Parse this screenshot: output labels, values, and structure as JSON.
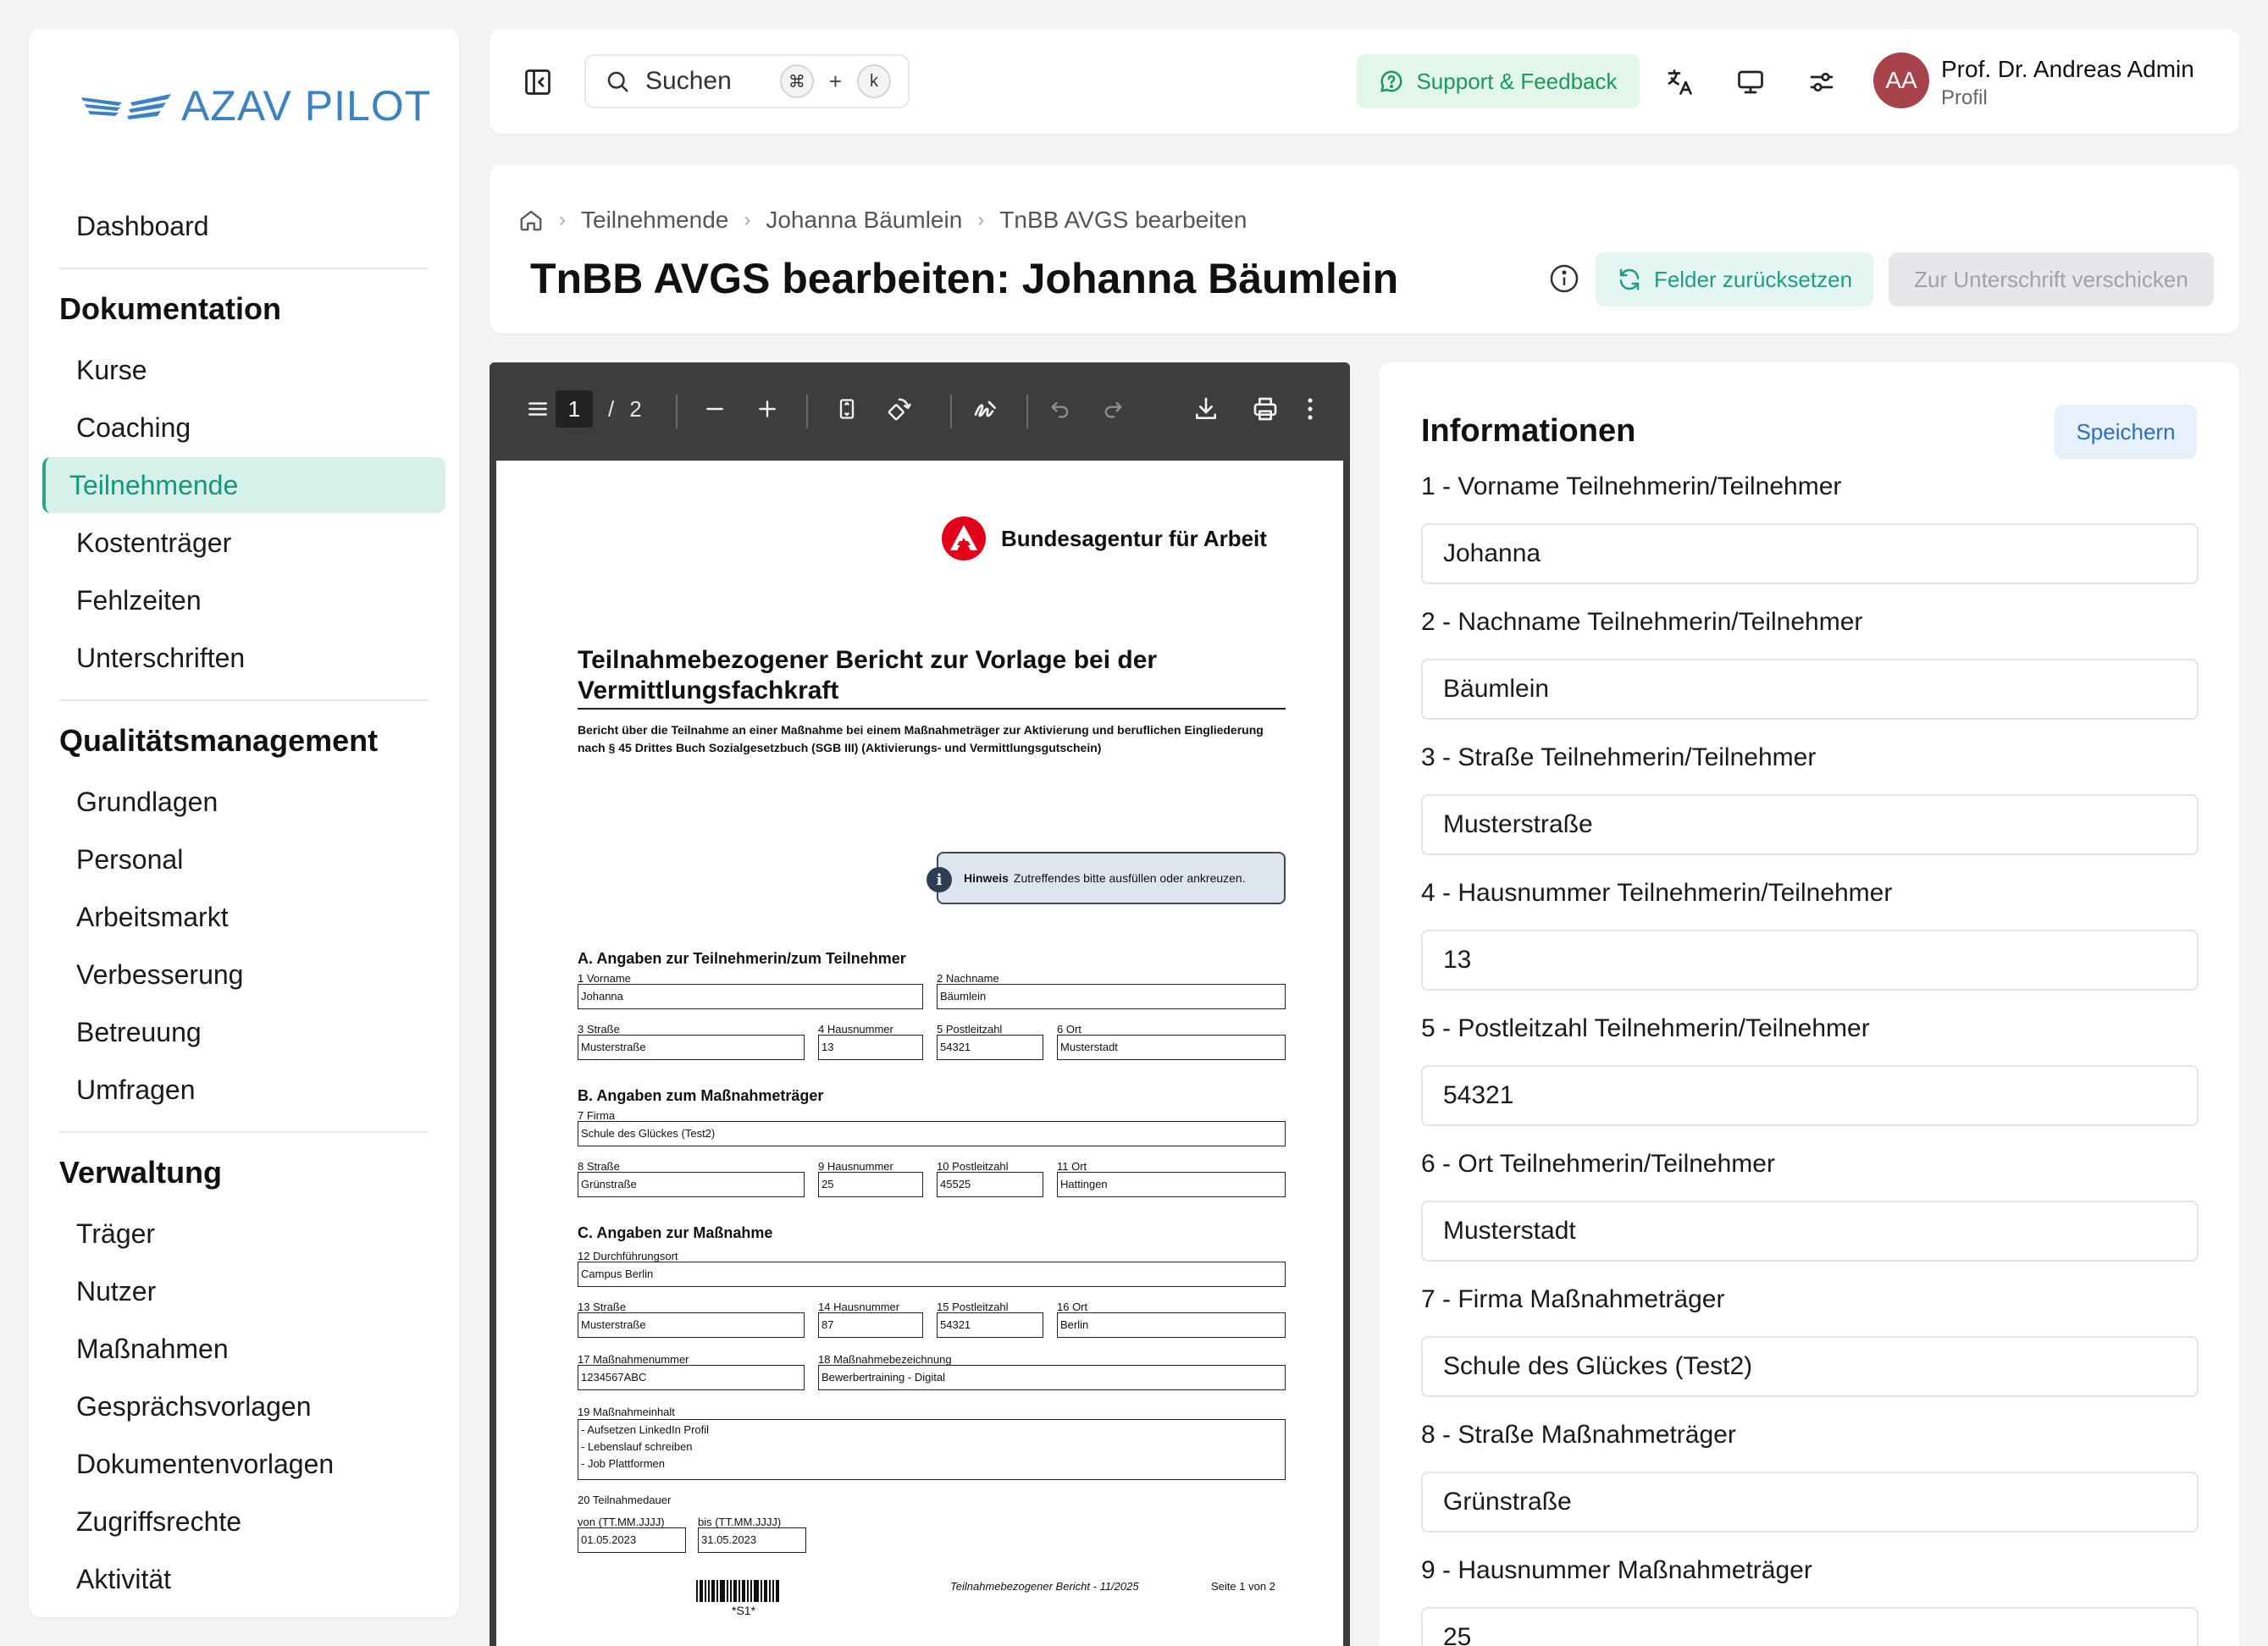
{
  "sidebar": {
    "logo_text": "AZAV PILOT",
    "dashboard": "Dashboard",
    "sections": [
      {
        "title": "Dokumentation",
        "items": [
          "Kurse",
          "Coaching",
          "Teilnehmende",
          "Kostenträger",
          "Fehlzeiten",
          "Unterschriften"
        ]
      },
      {
        "title": "Qualitätsmanagement",
        "items": [
          "Grundlagen",
          "Personal",
          "Arbeitsmarkt",
          "Verbesserung",
          "Betreuung",
          "Umfragen"
        ]
      },
      {
        "title": "Verwaltung",
        "items": [
          "Träger",
          "Nutzer",
          "Maßnahmen",
          "Gesprächsvorlagen",
          "Dokumentenvorlagen",
          "Zugriffsrechte",
          "Aktivität"
        ]
      }
    ],
    "active_item": "Teilnehmende"
  },
  "topbar": {
    "search_label": "Suchen",
    "shortcut_key1": "⌘",
    "shortcut_plus": "+",
    "shortcut_key2": "k",
    "support_label": "Support & Feedback",
    "avatar_initials": "AA",
    "user_name": "Prof. Dr. Andreas Admin",
    "user_sub": "Profil"
  },
  "header": {
    "breadcrumbs": [
      "Teilnehmende",
      "Johanna Bäumlein",
      "TnBB AVGS bearbeiten"
    ],
    "title": "TnBB AVGS bearbeiten: Johanna Bäumlein",
    "reset_label": "Felder zurücksetzen",
    "sign_label": "Zur Unterschrift verschicken"
  },
  "pdf": {
    "current_page": "1",
    "page_sep": "/",
    "total_pages": "2",
    "org_name": "Bundesagentur für Arbeit",
    "title": "Teilnahmebezogener Bericht zur Vorlage bei der Vermittlungsfachkraft",
    "intro": "Bericht über die Teilnahme an einer Maßnahme bei einem Maßnahmeträger zur Aktivierung und beruflichen Eingliederung nach § 45 Drittes Buch Sozialgesetzbuch (SGB III) (Aktivierungs- und Vermittlungsgutschein)",
    "hint_bold": "Hinweis",
    "hint_text": "Zutreffendes bitte ausfüllen oder ankreuzen.",
    "section_a": "A.  Angaben zur Teilnehmerin/zum Teilnehmer",
    "section_b": "B.  Angaben zum Maßnahmeträger",
    "section_c": "C.  Angaben zur Maßnahme",
    "labels": {
      "l1": "1  Vorname",
      "l2": "2  Nachname",
      "l3": "3  Straße",
      "l4": "4  Hausnummer",
      "l5": "5  Postleitzahl",
      "l6": "6  Ort",
      "l7": "7  Firma",
      "l8": "8  Straße",
      "l9": "9  Hausnummer",
      "l10": "10  Postleitzahl",
      "l11": "11  Ort",
      "l12": "12  Durchführungsort",
      "l13": "13  Straße",
      "l14": "14  Hausnummer",
      "l15": "15  Postleitzahl",
      "l16": "16  Ort",
      "l17": "17  Maßnahmenummer",
      "l18": "18  Maßnahmebezeichnung",
      "l19": "19  Maßnahmeinhalt",
      "l20": "20  Teilnahmedauer",
      "von": "von (TT.MM.JJJJ)",
      "bis": "bis (TT.MM.JJJJ)"
    },
    "values": {
      "v1": "Johanna",
      "v2": "Bäumlein",
      "v3": "Musterstraße",
      "v4": "13",
      "v5": "54321",
      "v6": "Musterstadt",
      "v7": "Schule des Glückes (Test2)",
      "v8": "Grünstraße",
      "v9": "25",
      "v10": "45525",
      "v11": "Hattingen",
      "v12": "Campus Berlin",
      "v13": "Musterstraße",
      "v14": "87",
      "v15": "54321",
      "v16": "Berlin",
      "v17": "1234567ABC",
      "v18": "Bewerbertraining - Digital",
      "v19": "- Aufsetzen LinkedIn Profil\n- Lebenslauf schreiben\n- Job Plattformen",
      "von": "01.05.2023",
      "bis": "31.05.2023"
    },
    "barcode_label": "*S1*",
    "footer_doc": "Teilnahmebezogener Bericht - 11/2025",
    "footer_page": "Seite 1 von 2"
  },
  "info": {
    "title": "Informationen",
    "save_label": "Speichern",
    "fields": [
      {
        "label": "1 - Vorname Teilnehmerin/Teilnehmer",
        "value": "Johanna"
      },
      {
        "label": "2 - Nachname Teilnehmerin/Teilnehmer",
        "value": "Bäumlein"
      },
      {
        "label": "3 - Straße Teilnehmerin/Teilnehmer",
        "value": "Musterstraße"
      },
      {
        "label": "4 - Hausnummer Teilnehmerin/Teilnehmer",
        "value": "13"
      },
      {
        "label": "5 - Postleitzahl Teilnehmerin/Teilnehmer",
        "value": "54321"
      },
      {
        "label": "6 - Ort Teilnehmerin/Teilnehmer",
        "value": "Musterstadt"
      },
      {
        "label": "7 - Firma Maßnahmeträger",
        "value": "Schule des Glückes (Test2)"
      },
      {
        "label": "8 - Straße Maßnahmeträger",
        "value": "Grünstraße"
      },
      {
        "label": "9 - Hausnummer Maßnahmeträger",
        "value": "25"
      }
    ]
  },
  "colors": {
    "accent": "#2aa58b",
    "brand_blue": "#3b82c4",
    "avatar": "#a8434b",
    "ba_red": "#e2001a"
  }
}
